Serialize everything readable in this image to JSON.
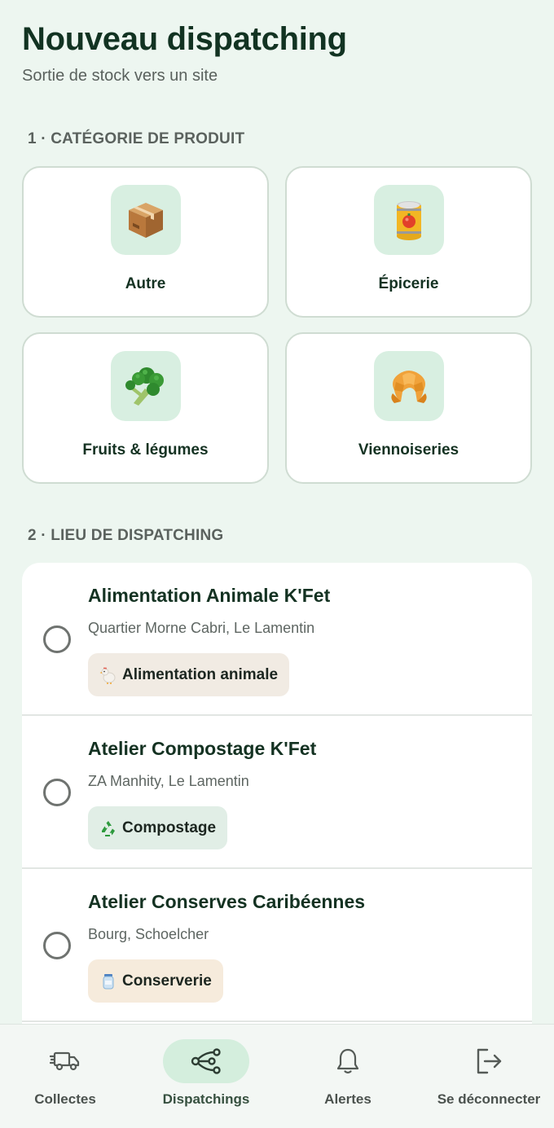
{
  "header": {
    "title": "Nouveau dispatching",
    "subtitle": "Sortie de stock vers un site"
  },
  "section_category": {
    "heading": "1 · CATÉGORIE DE PRODUIT"
  },
  "categories": [
    {
      "label": "Autre",
      "icon": "package-icon"
    },
    {
      "label": "Épicerie",
      "icon": "canned-food-icon"
    },
    {
      "label": "Fruits & légumes",
      "icon": "broccoli-icon"
    },
    {
      "label": "Viennoiseries",
      "icon": "croissant-icon"
    }
  ],
  "section_site": {
    "heading": "2 · LIEU DE DISPATCHING"
  },
  "sites": [
    {
      "name": "Alimentation Animale K'Fet",
      "address": "Quartier Morne Cabri, Le Lamentin",
      "badge": "Alimentation animale",
      "badge_icon": "chicken-icon",
      "badge_color": "#f1ebe3",
      "selected": false
    },
    {
      "name": "Atelier Compostage K'Fet",
      "address": "ZA Manhity, Le Lamentin",
      "badge": "Compostage",
      "badge_icon": "recycle-icon",
      "badge_color": "#e1eee6",
      "selected": false
    },
    {
      "name": "Atelier Conserves Caribéennes",
      "address": "Bourg, Schoelcher",
      "badge": "Conserverie",
      "badge_icon": "jar-icon",
      "badge_color": "#f6ebdc",
      "selected": false
    }
  ],
  "bottom_nav": [
    {
      "label": "Collectes",
      "icon": "truck-icon",
      "active": false
    },
    {
      "label": "Dispatchings",
      "icon": "share-nodes-icon",
      "active": true
    },
    {
      "label": "Alertes",
      "icon": "bell-icon",
      "active": false
    },
    {
      "label": "Se déconnecter",
      "icon": "logout-icon",
      "active": false
    }
  ],
  "colors": {
    "background": "#edf6f0",
    "title": "#123322",
    "accent_light": "#d8efe1",
    "card_border": "#cfdcd2"
  }
}
